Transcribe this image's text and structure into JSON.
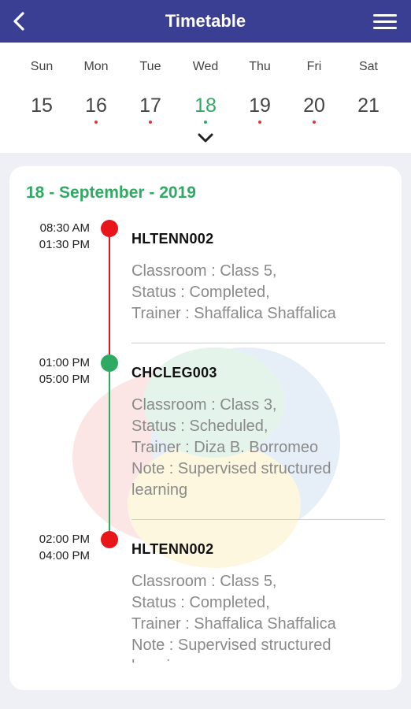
{
  "header": {
    "title": "Timetable",
    "bg_color": "#3b3f93"
  },
  "week": {
    "days": [
      {
        "name": "Sun",
        "date": "15",
        "has_event": false,
        "selected": false
      },
      {
        "name": "Mon",
        "date": "16",
        "has_event": true,
        "selected": false
      },
      {
        "name": "Tue",
        "date": "17",
        "has_event": true,
        "selected": false
      },
      {
        "name": "Wed",
        "date": "18",
        "has_event": true,
        "selected": true
      },
      {
        "name": "Thu",
        "date": "19",
        "has_event": true,
        "selected": false
      },
      {
        "name": "Fri",
        "date": "20",
        "has_event": true,
        "selected": false
      },
      {
        "name": "Sat",
        "date": "21",
        "has_event": false,
        "selected": false
      }
    ],
    "event_dot_color": "#e53935",
    "selected_dot_color": "#2eaa63"
  },
  "schedule": {
    "date_label": "18 - September - 2019",
    "accent_color": "#2eaa63",
    "events": [
      {
        "start": "08:30 AM",
        "end": "01:30 PM",
        "code": "HLTENN002",
        "status_color": "#e8161b",
        "lines": [
          "Classroom : Class 5,",
          "Status : Completed,",
          "Trainer : Shaffalica Shaffalica"
        ]
      },
      {
        "start": "01:00 PM",
        "end": "05:00 PM",
        "code": "CHCLEG003",
        "status_color": "#2eaa63",
        "lines": [
          "Classroom : Class 3,",
          "Status : Scheduled,",
          "Trainer : Diza B. Borromeo",
          "Note : Supervised structured",
          "learning"
        ]
      },
      {
        "start": "02:00 PM",
        "end": "04:00 PM",
        "code": "HLTENN002",
        "status_color": "#e8161b",
        "lines": [
          "Classroom : Class 5,",
          "Status : Completed,",
          "Trainer : Shaffalica Shaffalica",
          "Note : Supervised structured",
          "learning"
        ]
      }
    ]
  },
  "icons": {
    "back": "chevron-left-icon",
    "menu": "hamburger-menu-icon",
    "expand": "chevron-down-icon"
  }
}
